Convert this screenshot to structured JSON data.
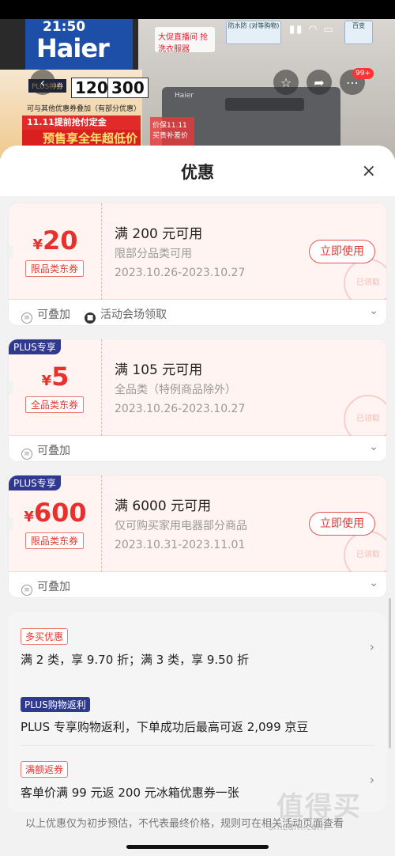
{
  "status_bar": {
    "time": "21:50",
    "battery": "99+"
  },
  "banner": {
    "brand": "Haier",
    "plus_tag": "PLUS神券",
    "amount1": "120",
    "amount2": "300",
    "note": "可与其他优惠券叠加（有部分优惠）",
    "strip1": "11.11提前抢付定金",
    "strip2": "预售享全年超低价",
    "live_tag": "大促直播间 抢洗衣服器",
    "price_badge": "价保11.11 买贵补差价",
    "icon_box1": "防水防 (对等购物)",
    "icon_box2": "百变",
    "washer_brand": "Haier"
  },
  "sheet": {
    "title": "优惠",
    "close": "×"
  },
  "coupons": [
    {
      "plus": "",
      "yen": "¥",
      "amount": "20",
      "tag": "限品类东券",
      "condition": "满 200 元可用",
      "scope": "限部分品类可用",
      "date": "2023.10.26-2023.10.27",
      "button": "立即使用",
      "stamp": "已领取",
      "foot1": "可叠加",
      "foot2": "活动会场领取"
    },
    {
      "plus": "PLUS专享",
      "yen": "¥",
      "amount": "5",
      "tag": "全品类东券",
      "condition": "满 105 元可用",
      "scope": "全品类（特例商品除外）",
      "date": "2023.10.26-2023.10.27",
      "button": "",
      "stamp": "已领取",
      "foot1": "可叠加",
      "foot2": ""
    },
    {
      "plus": "PLUS专享",
      "yen": "¥",
      "amount": "600",
      "tag": "限品类东券",
      "condition": "满 6000 元可用",
      "scope": "仅可购买家用电器部分商品",
      "date": "2023.10.31-2023.11.01",
      "button": "立即使用",
      "stamp": "已领取",
      "foot1": "可叠加",
      "foot2": ""
    }
  ],
  "promotions": [
    {
      "tag": "多买优惠",
      "text": "满 2 类，享 9.70 折；满 3 类，享 9.50 折",
      "style": "red"
    },
    {
      "tag": "PLUS购物返利",
      "text": "PLUS 专享购物返利，下单成功后最高可返 2,099 京豆",
      "style": "blue"
    },
    {
      "tag": "满额返券",
      "text": "客单价满 99 元返 200 元冰箱优惠券一张",
      "style": "red"
    }
  ],
  "disclaimer": "以上优惠仅为初步预估，不代表最终价格，规则可在相关活动页面查看",
  "watermark": "值得买",
  "watermark_url": "smzdm.com"
}
